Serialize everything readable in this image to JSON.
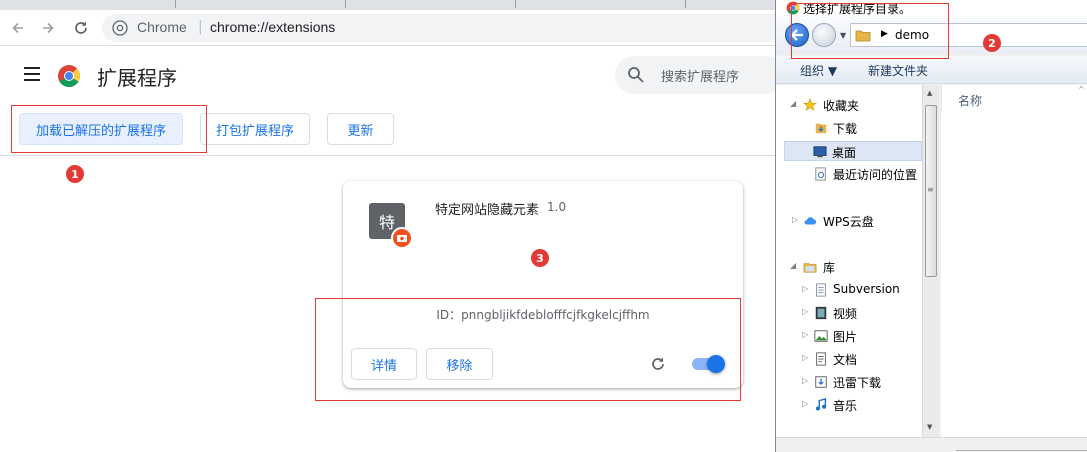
{
  "chrome": {
    "omnibox": {
      "site_name": "Chrome",
      "divider": "|",
      "url": "chrome://extensions"
    },
    "header": {
      "title": "扩展程序",
      "search_placeholder": "搜索扩展程序"
    },
    "actions": {
      "load_unpacked": "加载已解压的扩展程序",
      "pack": "打包扩展程序",
      "update": "更新"
    },
    "extension": {
      "icon_char": "特",
      "name": "特定网站隐藏元素",
      "version": "1.0",
      "id_text": "ID：pnngbljikfdeblofffcjfkgkelcjffhm",
      "details_label": "详情",
      "remove_label": "移除",
      "enabled": true
    }
  },
  "annotations": {
    "one": "1",
    "two": "2",
    "three": "3"
  },
  "dialog": {
    "title": "选择扩展程序目录。",
    "address": {
      "path": "demo"
    },
    "commands": {
      "organize": "组织 ▼",
      "new_folder": "新建文件夹"
    },
    "tree": {
      "favorites": "收藏夹",
      "downloads": "下载",
      "desktop": "桌面",
      "recent": "最近访问的位置",
      "wps": "WPS云盘",
      "libraries": "库",
      "subversion": "Subversion",
      "videos": "视频",
      "pictures": "图片",
      "documents": "文档",
      "xunlei": "迅雷下载",
      "music": "音乐"
    },
    "list": {
      "column_name": "名称"
    }
  },
  "colors": {
    "chrome_blue": "#1a73e8",
    "annotation_red": "#e53935"
  }
}
